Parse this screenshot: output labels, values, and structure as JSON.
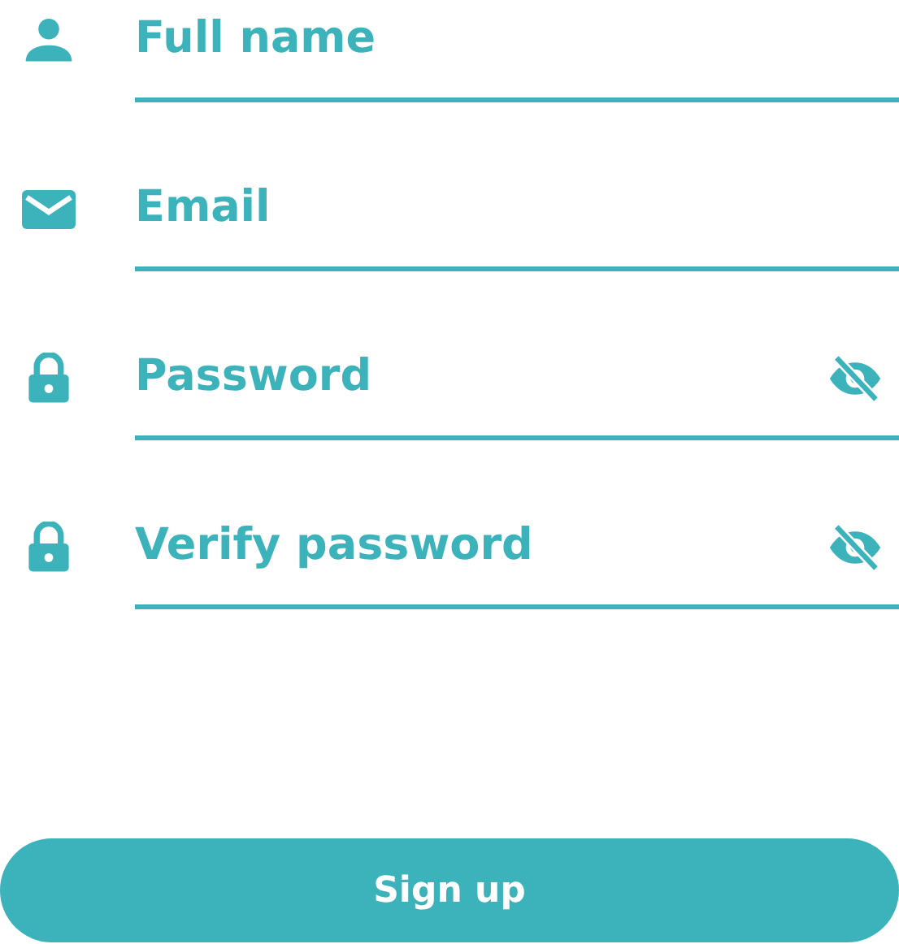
{
  "fields": [
    {
      "kind": "name",
      "placeholder": "Full name"
    },
    {
      "kind": "email",
      "placeholder": "Email"
    },
    {
      "kind": "password",
      "placeholder": "Password",
      "password_hidden": true
    },
    {
      "kind": "password",
      "placeholder": "Verify password",
      "password_hidden": true
    }
  ],
  "submit_button": {
    "label": "Sign up"
  }
}
